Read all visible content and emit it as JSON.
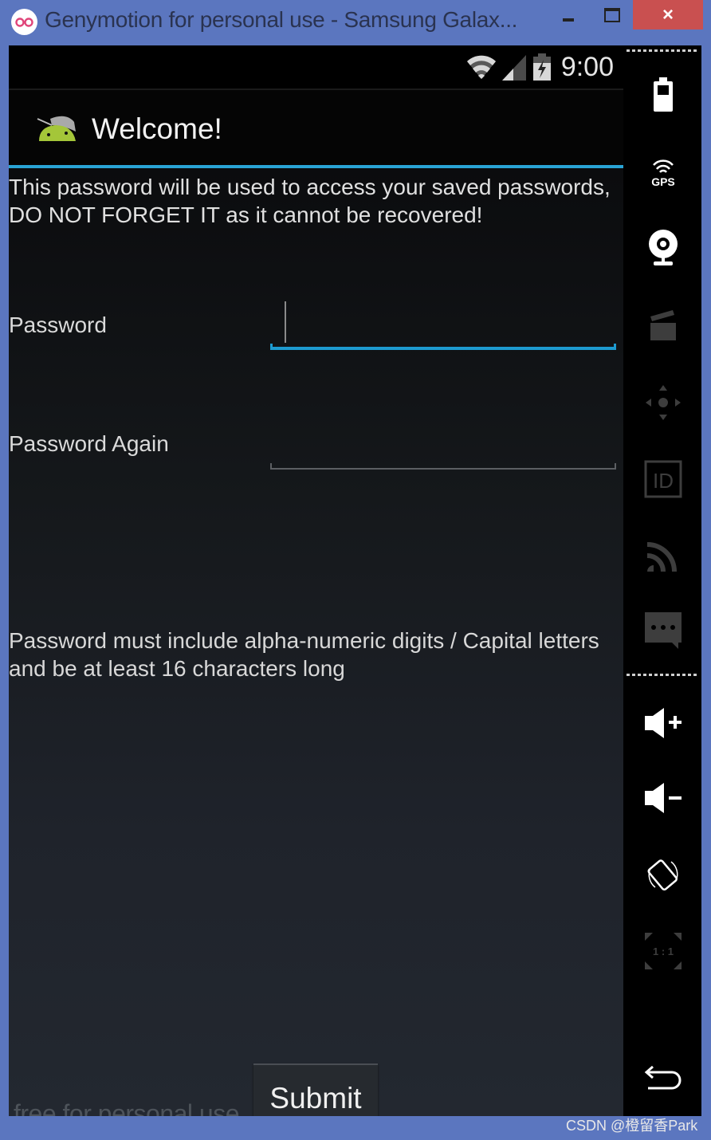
{
  "window": {
    "title": "Genymotion for personal use - Samsung Galax...",
    "logo_icon": "genymotion-logo-icon",
    "controls": {
      "minimize": "minimize-icon",
      "maximize": "maximize-icon",
      "close_label": "×"
    },
    "colors": {
      "frame": "#5b76bf",
      "close": "#c95050"
    }
  },
  "statusbar": {
    "icons": [
      "wifi-icon",
      "signal-icon",
      "battery-charging-icon"
    ],
    "time": "9:00"
  },
  "actionbar": {
    "icon": "android-app-icon",
    "title": "Welcome!",
    "accent_color": "#2aa4d6"
  },
  "form": {
    "intro": "This password will be used to access your saved passwords, DO NOT FORGET IT as it cannot be recovered!",
    "password_label": "Password",
    "password_value": "",
    "password_again_label": "Password Again",
    "password_again_value": "",
    "hint": "Password must include alpha-numeric digits / Capital letters and be at least 16 characters long",
    "submit_label": "Submit"
  },
  "watermark": "free for personal use",
  "sidebar": {
    "items": [
      {
        "name": "battery-icon",
        "enabled": true
      },
      {
        "name": "gps-icon",
        "label": "GPS",
        "enabled": true
      },
      {
        "name": "webcam-icon",
        "enabled": true
      },
      {
        "name": "media-clapper-icon",
        "enabled": false
      },
      {
        "name": "dpad-icon",
        "enabled": false
      },
      {
        "name": "device-id-icon",
        "label": "ID",
        "enabled": false
      },
      {
        "name": "network-rss-icon",
        "enabled": false
      },
      {
        "name": "sms-message-icon",
        "enabled": false
      },
      {
        "name": "volume-up-icon",
        "enabled": true
      },
      {
        "name": "volume-down-icon",
        "enabled": true
      },
      {
        "name": "rotate-icon",
        "enabled": true
      },
      {
        "name": "scale-1-1-icon",
        "label": "1 : 1",
        "enabled": false
      },
      {
        "name": "back-icon",
        "enabled": true
      }
    ]
  },
  "credit": "CSDN @橙留香Park"
}
